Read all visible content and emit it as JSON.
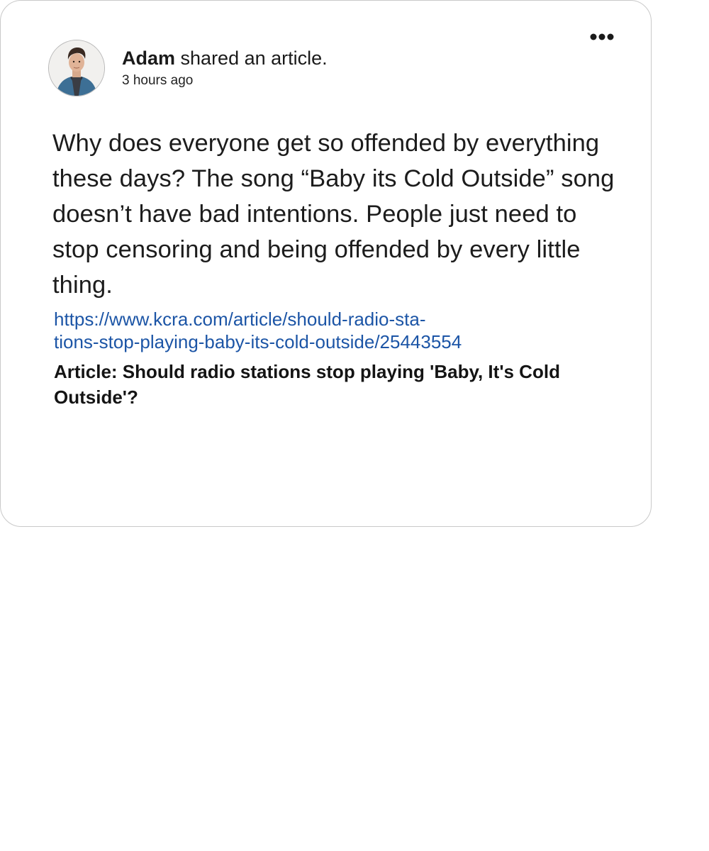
{
  "post": {
    "author": "Adam",
    "action": "shared an article.",
    "timestamp": "3 hours ago",
    "text": "Why does everyone get so offended by everything these days? The song “Baby its Cold Outside” song doesn’t have bad intentions. People just need to stop censoring and being offended by every little thing.",
    "link": {
      "text_line1": "https://www.kcra.com/article/should-radio-sta-",
      "text_line2": "tions-stop-playing-baby-its-cold-outside/25443554",
      "href": "https://www.kcra.com/article/should-radio-stations-stop-playing-baby-its-cold-outside/25443554"
    },
    "article_title": "Article: Should radio stations stop playing 'Baby, It's Cold Outside'?"
  },
  "icons": {
    "more": "more-options-icon",
    "avatar": "user-avatar"
  },
  "colors": {
    "link": "#1c55a6",
    "text": "#1a1a1a",
    "card_border": "#c9c9c9"
  }
}
